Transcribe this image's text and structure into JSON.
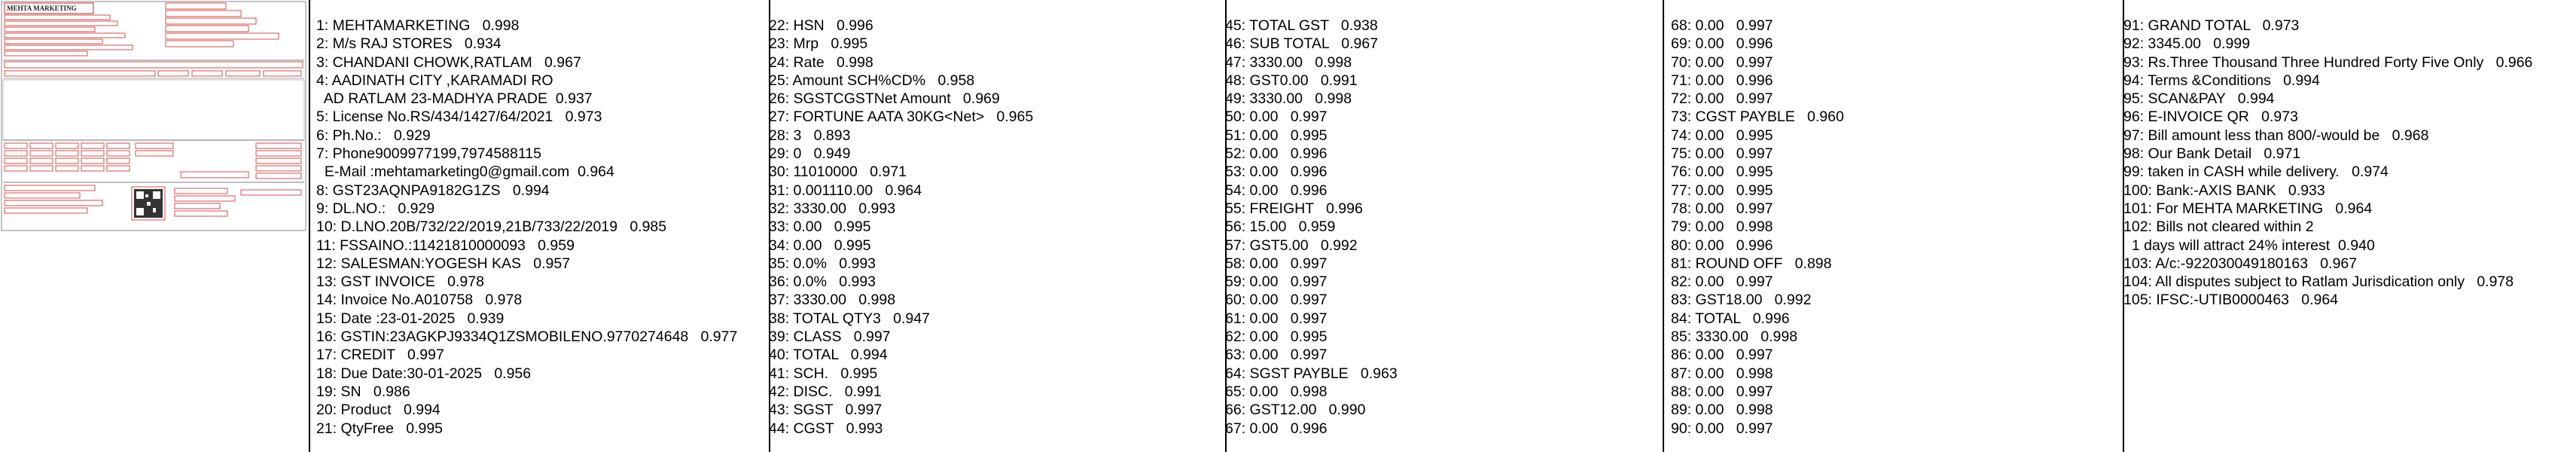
{
  "thumbnail": {
    "header_text": "MEHTA MARKETING",
    "accent_color": "#cc2222"
  },
  "columns": [
    [
      "1: MEHTAMARKETING   0.998",
      "2: M/s RAJ STORES   0.934",
      "3: CHANDANI CHOWK,RATLAM   0.967",
      "4: AADINATH CITY ,KARAMADI RO",
      "  AD RATLAM 23-MADHYA PRADE  0.937",
      "5: License No.RS/434/1427/64/2021   0.973",
      "6: Ph.No.:   0.929",
      "7: Phone9009977199,7974588115",
      "  E-Mail :mehtamarketing0@gmail.com  0.964",
      "8: GST23AQNPA9182G1ZS   0.994",
      "9: DL.NO.:   0.929",
      "10: D.LNO.20B/732/22/2019,21B/733/22/2019   0.985",
      "11: FSSAINO.:11421810000093   0.959",
      "12: SALESMAN:YOGESH KAS   0.957",
      "13: GST INVOICE   0.978",
      "14: Invoice No.A010758   0.978",
      "15: Date :23-01-2025   0.939",
      "16: GSTIN:23AGKPJ9334Q1ZSMOBILENO.9770274648   0.977",
      "17: CREDIT   0.997",
      "18: Due Date:30-01-2025   0.956",
      "19: SN   0.986",
      "20: Product   0.994",
      "21: QtyFree   0.995"
    ],
    [
      "22: HSN   0.996",
      "23: Mrp   0.995",
      "24: Rate   0.998",
      "25: Amount SCH%CD%   0.958",
      "26: SGSTCGSTNet Amount   0.969",
      "27: FORTUNE AATA 30KG<Net>   0.965",
      "28: 3   0.893",
      "29: 0   0.949",
      "30: 11010000   0.971",
      "31: 0.001110.00   0.964",
      "32: 3330.00   0.993",
      "33: 0.00   0.995",
      "34: 0.00   0.995",
      "35: 0.0%   0.993",
      "36: 0.0%   0.993",
      "37: 3330.00   0.998",
      "38: TOTAL QTY3   0.947",
      "39: CLASS   0.997",
      "40: TOTAL   0.994",
      "41: SCH.   0.995",
      "42: DISC.   0.991",
      "43: SGST   0.997",
      "44: CGST   0.993"
    ],
    [
      "45: TOTAL GST   0.938",
      "46: SUB TOTAL   0.967",
      "47: 3330.00   0.998",
      "48: GST0.00   0.991",
      "49: 3330.00   0.998",
      "50: 0.00   0.997",
      "51: 0.00   0.995",
      "52: 0.00   0.996",
      "53: 0.00   0.996",
      "54: 0.00   0.996",
      "55: FREIGHT   0.996",
      "56: 15.00   0.959",
      "57: GST5.00   0.992",
      "58: 0.00   0.997",
      "59: 0.00   0.997",
      "60: 0.00   0.997",
      "61: 0.00   0.997",
      "62: 0.00   0.995",
      "63: 0.00   0.997",
      "64: SGST PAYBLE   0.963",
      "65: 0.00   0.998",
      "66: GST12.00   0.990",
      "67: 0.00   0.996"
    ],
    [
      "68: 0.00   0.997",
      "69: 0.00   0.996",
      "70: 0.00   0.997",
      "71: 0.00   0.996",
      "72: 0.00   0.997",
      "73: CGST PAYBLE   0.960",
      "74: 0.00   0.995",
      "75: 0.00   0.997",
      "76: 0.00   0.995",
      "77: 0.00   0.995",
      "78: 0.00   0.997",
      "79: 0.00   0.998",
      "80: 0.00   0.996",
      "81: ROUND OFF   0.898",
      "82: 0.00   0.997",
      "83: GST18.00   0.992",
      "84: TOTAL   0.996",
      "85: 3330.00   0.998",
      "86: 0.00   0.997",
      "87: 0.00   0.998",
      "88: 0.00   0.997",
      "89: 0.00   0.998",
      "90: 0.00   0.997"
    ],
    [
      "91: GRAND TOTAL   0.973",
      "92: 3345.00   0.999",
      "93: Rs.Three Thousand Three Hundred Forty Five Only   0.966",
      "94: Terms &Conditions   0.994",
      "95: SCAN&PAY   0.994",
      "96: E-INVOICE QR   0.973",
      "97: Bill amount less than 800/-would be   0.968",
      "98: Our Bank Detail   0.971",
      "99: taken in CASH while delivery.   0.974",
      "100: Bank:-AXIS BANK   0.933",
      "101: For MEHTA MARKETING   0.964",
      "102: Bills not cleared within 2",
      "  1 days will attract 24% interest  0.940",
      "103: A/c:-922030049180163   0.967",
      "104: All disputes subject to Ratlam Jurisdication only   0.978",
      "105: IFSC:-UTIB0000463   0.964"
    ]
  ]
}
